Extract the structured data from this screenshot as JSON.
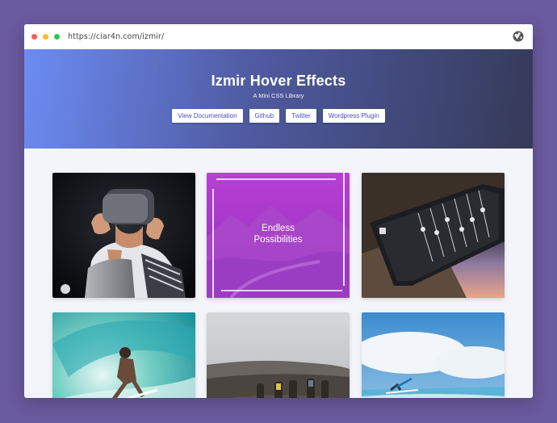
{
  "browser": {
    "url": "https://ciar4n.com/izmir/",
    "icons": [
      "close-dot",
      "minimize-dot",
      "maximize-dot",
      "globe-icon"
    ],
    "colors": {
      "close": "#f25f57",
      "minimize": "#f8bd2e",
      "maximize": "#2fc84a"
    }
  },
  "hero": {
    "title": "Izmir Hover Effects",
    "subtitle": "A Mini CSS Library",
    "buttons": [
      {
        "label": "View Documentation"
      },
      {
        "label": "Github"
      },
      {
        "label": "Twitter"
      },
      {
        "label": "Wordpress Plugin"
      }
    ],
    "accent_color": "#4d4ec8"
  },
  "gallery": {
    "cards": [
      {
        "subject": "person-with-vr-headset"
      },
      {
        "subject": "mountain-landscape",
        "overlay_text": "Endless\nPossibilities",
        "overlay_color": "#a03ad0"
      },
      {
        "subject": "mixing-console-sunset"
      },
      {
        "subject": "surfer-in-wave"
      },
      {
        "subject": "hikers-on-hill"
      },
      {
        "subject": "surfer-on-beach"
      }
    ]
  }
}
